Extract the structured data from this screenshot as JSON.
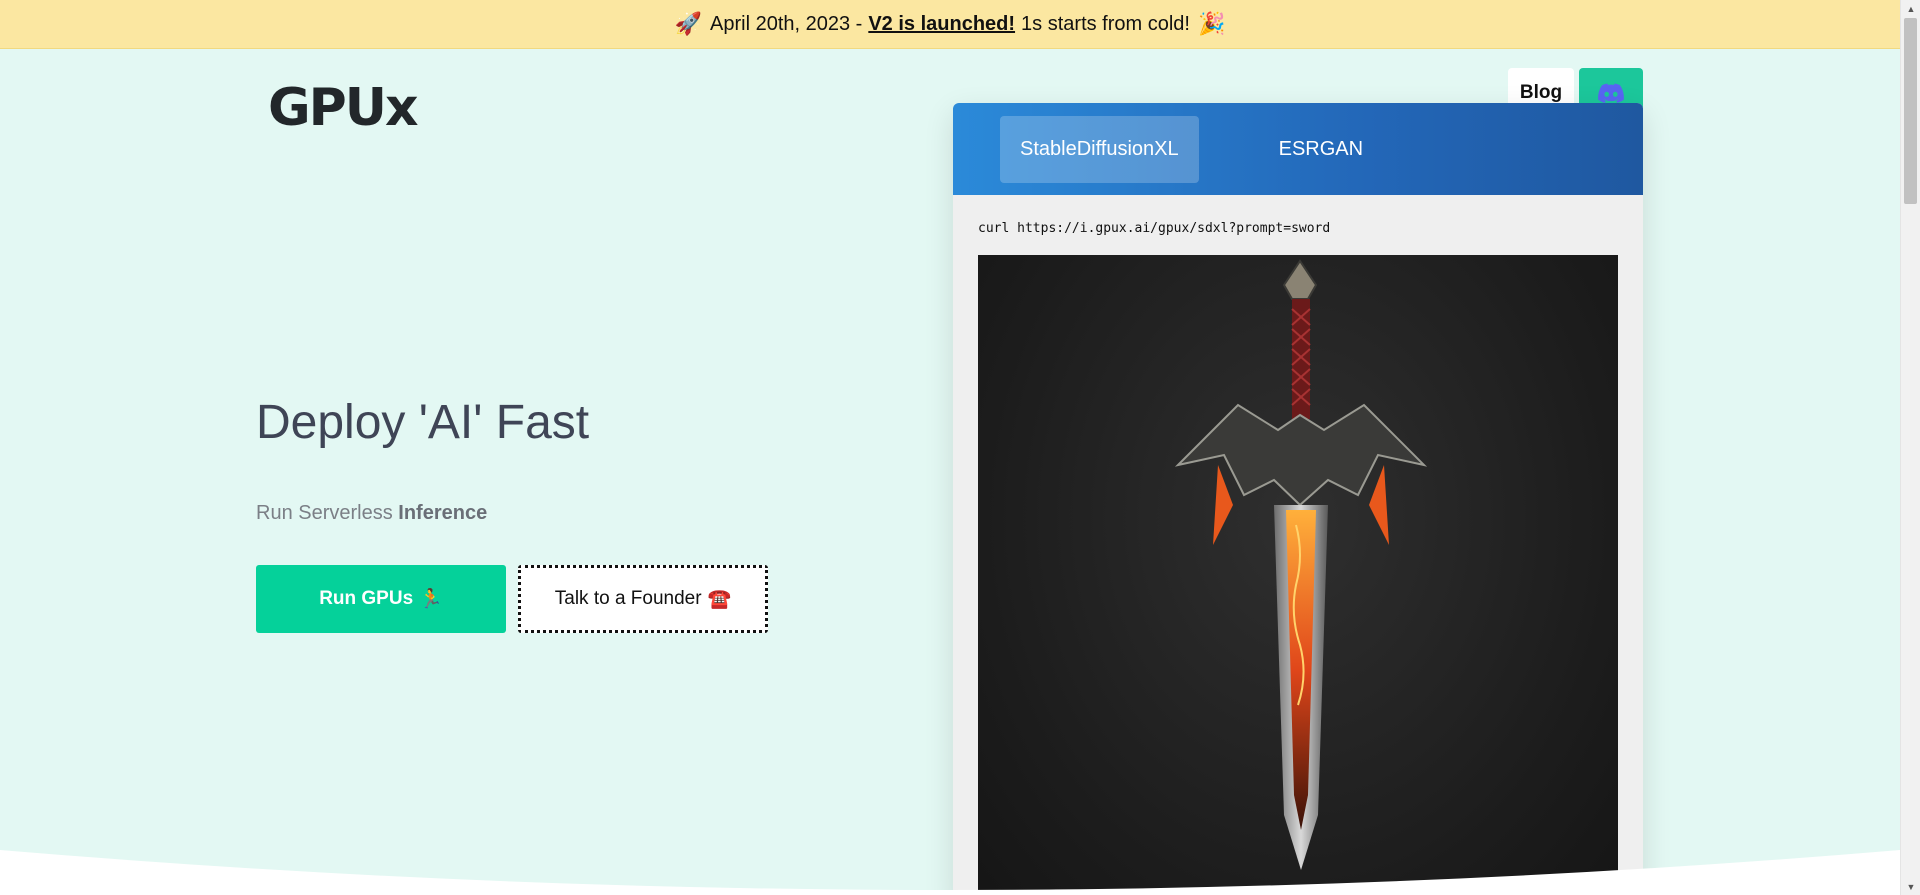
{
  "announcement": {
    "rocket_icon": "🚀",
    "date_text": "April 20th, 2023 -",
    "link_text": "V2 is launched!",
    "tail_text": "1s starts from cold!",
    "party_icon": "🎉"
  },
  "header": {
    "logo": "GPUx",
    "nav": {
      "blog_label": "Blog",
      "discord_icon": "discord-icon"
    }
  },
  "hero": {
    "title": "Deploy 'AI' Fast",
    "subtitle_prefix": "Run Serverless",
    "subtitle_bold": "Inference",
    "primary_button": {
      "label": "Run GPUs",
      "emoji": "🏃"
    },
    "secondary_button": {
      "label": "Talk to a Founder",
      "emoji": "☎️"
    }
  },
  "demo": {
    "tabs": [
      {
        "label": "StableDiffusionXL",
        "active": true
      },
      {
        "label": "ESRGAN",
        "active": false
      }
    ],
    "command": "curl https://i.gpux.ai/gpux/sdxl?prompt=sword",
    "image_icon": "sword-image"
  },
  "colors": {
    "page_bg": "#e3f8f3",
    "banner_bg": "#fbe7a1",
    "accent_green": "#05d19a",
    "tab_gradient_start": "#2b8ad9",
    "tab_gradient_end": "#1f58a0"
  }
}
